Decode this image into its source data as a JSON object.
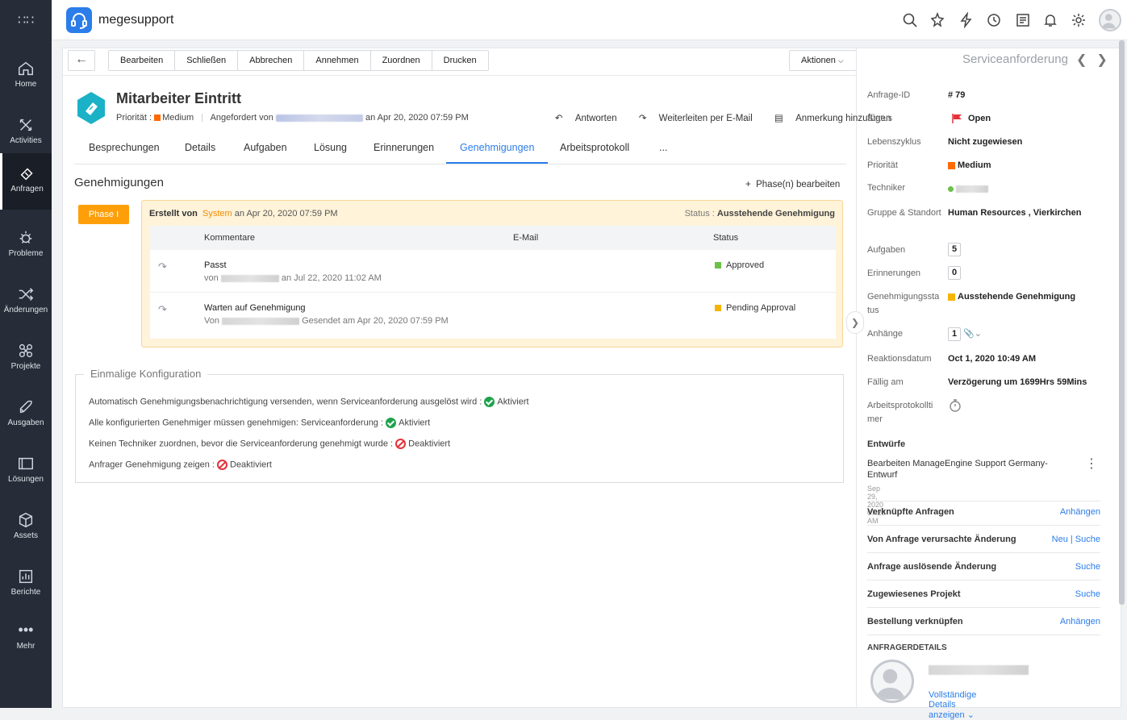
{
  "app": {
    "name": "megesupport"
  },
  "sidebar": {
    "items": [
      {
        "label": "Home",
        "icon": "home-icon"
      },
      {
        "label": "Activities",
        "icon": "activities-icon"
      },
      {
        "label": "Anfragen",
        "icon": "ticket-icon",
        "active": true
      },
      {
        "label": "Probleme",
        "icon": "bug-icon"
      },
      {
        "label": "Änderungen",
        "icon": "shuffle-icon"
      },
      {
        "label": "Projekte",
        "icon": "projects-icon"
      },
      {
        "label": "Ausgaben",
        "icon": "rocket-icon"
      },
      {
        "label": "Lösungen",
        "icon": "book-icon"
      },
      {
        "label": "Assets",
        "icon": "cube-icon"
      },
      {
        "label": "Berichte",
        "icon": "chart-icon"
      },
      {
        "label": "Mehr",
        "icon": "more-dots-icon"
      }
    ]
  },
  "toolbar": {
    "buttons": [
      "Bearbeiten",
      "Schließen",
      "Abbrechen",
      "Annehmen",
      "Zuordnen",
      "Drucken"
    ],
    "aktionen": "Aktionen",
    "request_type": "Serviceanforderung"
  },
  "request": {
    "title": "Mitarbeiter Eintritt",
    "priority_label": "Priorität :",
    "priority": "Medium",
    "priority_color": "#ff6a00",
    "requested_by_label": "Angefordert von",
    "requested_on": "an Apr 20, 2020 07:59 PM"
  },
  "actions": {
    "reply": "Antworten",
    "forward": "Weiterleiten per E-Mail",
    "note": "Anmerkung hinzufügen"
  },
  "tabs": [
    "Besprechungen",
    "Details",
    "Aufgaben",
    "Lösung",
    "Erinnerungen",
    "Genehmigungen",
    "Arbeitsprotokoll",
    "..."
  ],
  "approvals": {
    "section_title": "Genehmigungen",
    "edit_phase": "Phase(n) bearbeiten",
    "phase_label": "Phase I",
    "created_by_label": "Erstellt von",
    "created_by": "System",
    "created_on": "an Apr 20, 2020 07:59 PM",
    "status_label": "Status :",
    "status": "Ausstehende Genehmigung",
    "columns": [
      "Kommentare",
      "E-Mail",
      "Status"
    ],
    "rows": [
      {
        "comment": "Passt",
        "sub_prefix": "von",
        "sub_suffix": "an Jul 22, 2020 11:02 AM",
        "status": "Approved",
        "status_color": "#6cc04a"
      },
      {
        "comment": "Warten auf Genehmigung",
        "sub_prefix": "Von",
        "sub_suffix": "Gesendet am Apr 20, 2020 07:59 PM",
        "status": "Pending Approval",
        "status_color": "#f5b400"
      }
    ]
  },
  "config": {
    "title": "Einmalige Konfiguration",
    "lines": [
      {
        "text": "Automatisch Genehmigungsbenachrichtigung versenden, wenn Serviceanforderung ausgelöst wird :",
        "value": "Aktiviert",
        "on": true
      },
      {
        "text": "Alle konfigurierten Genehmiger müssen genehmigen: Serviceanforderung :",
        "value": "Aktiviert",
        "on": true
      },
      {
        "text": "Keinen Techniker zuordnen, bevor die Serviceanforderung genehmigt wurde :",
        "value": "Deaktiviert",
        "on": false
      },
      {
        "text": "Anfrager Genehmigung zeigen :",
        "value": "Deaktiviert",
        "on": false
      }
    ]
  },
  "properties": {
    "id_label": "Anfrage-ID",
    "id": "# 79",
    "status_label": "Status",
    "status": "Open",
    "lifecycle_label": "Lebenszyklus",
    "lifecycle": "Nicht zugewiesen",
    "priority_label": "Priorität",
    "priority": "Medium",
    "technician_label": "Techniker",
    "group_label": "Gruppe & Standort",
    "group": "Human Resources , Vierkirchen",
    "tasks_label": "Aufgaben",
    "tasks": "5",
    "reminders_label": "Erinnerungen",
    "reminders": "0",
    "approval_status_label": "Genehmigungssta tus",
    "approval_status": "Ausstehende Genehmigung",
    "approval_status_color": "#f5b400",
    "attachments_label": "Anhänge",
    "attachments": "1",
    "response_date_label": "Reaktionsdatum",
    "response_date": "Oct 1, 2020 10:49 AM",
    "due_label": "Fällig am",
    "due": "Verzögerung um 1699Hrs 59Mins",
    "worklog_timer_label": "Arbeitsprotokollti mer"
  },
  "drafts": {
    "title": "Entwürfe",
    "item_title": "Bearbeiten ManageEngine Support Germany-Entwurf",
    "item_date": "Sep 29, 2020 07:28 AM"
  },
  "links": [
    {
      "label": "Verknüpfte Anfragen",
      "action": "Anhängen"
    },
    {
      "label": "Von Anfrage verursachte Änderung",
      "action": "Neu |  Suche"
    },
    {
      "label": "Anfrage auslösende Änderung",
      "action": "Suche"
    },
    {
      "label": "Zugewiesenes Projekt",
      "action": "Suche"
    },
    {
      "label": "Bestellung verknüpfen",
      "action": "Anhängen"
    }
  ],
  "requester": {
    "section": "ANFRAGERDETAILS",
    "details_link": "Vollständige Details anzeigen"
  }
}
